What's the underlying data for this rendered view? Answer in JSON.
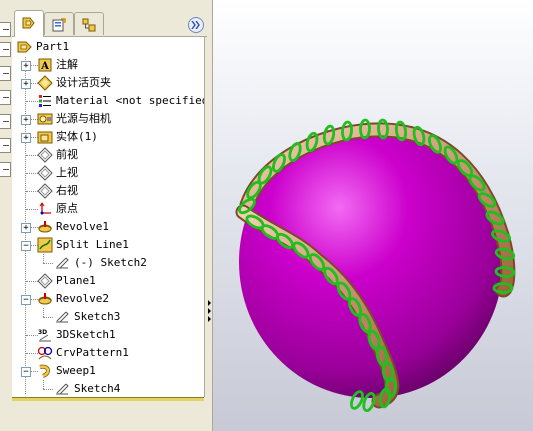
{
  "left_strip": {
    "boxes": [
      "",
      "",
      "",
      "",
      "",
      "",
      ""
    ]
  },
  "panel": {
    "tabs": [
      {
        "icon": "feature-manager-icon",
        "active": true
      },
      {
        "icon": "property-manager-icon",
        "active": false
      },
      {
        "icon": "configuration-manager-icon",
        "active": false
      }
    ],
    "expand_icon": "double-chevron-right-icon"
  },
  "tree": {
    "root": {
      "label": "Part1",
      "icon": "part-icon"
    },
    "items": [
      {
        "label": "注解",
        "icon": "annotations-icon",
        "expander": "+"
      },
      {
        "label": "设计活页夹",
        "icon": "design-binder-icon",
        "expander": "+"
      },
      {
        "label": "Material <not specified>",
        "icon": "material-icon",
        "expander": ""
      },
      {
        "label": "光源与相机",
        "icon": "lights-cameras-icon",
        "expander": "+"
      },
      {
        "label": "实体(1)",
        "icon": "solid-bodies-icon",
        "expander": "+"
      },
      {
        "label": "前视",
        "icon": "plane-icon",
        "expander": ""
      },
      {
        "label": "上视",
        "icon": "plane-icon",
        "expander": ""
      },
      {
        "label": "右视",
        "icon": "plane-icon",
        "expander": ""
      },
      {
        "label": "原点",
        "icon": "origin-icon",
        "expander": ""
      },
      {
        "label": "Revolve1",
        "icon": "revolve-icon",
        "expander": "+"
      },
      {
        "label": "Split Line1",
        "icon": "split-line-icon",
        "expander": "−"
      },
      {
        "label": "(-) Sketch2",
        "icon": "sketch-icon",
        "expander": "",
        "child": true
      },
      {
        "label": "Plane1",
        "icon": "plane-icon",
        "expander": ""
      },
      {
        "label": "Revolve2",
        "icon": "revolve-icon",
        "expander": "−"
      },
      {
        "label": "Sketch3",
        "icon": "sketch-icon",
        "expander": "",
        "child": true
      },
      {
        "label": "3DSketch1",
        "icon": "3d-sketch-icon",
        "expander": ""
      },
      {
        "label": "CrvPattern1",
        "icon": "curve-pattern-icon",
        "expander": ""
      },
      {
        "label": "Sweep1",
        "icon": "sweep-icon",
        "expander": "−"
      },
      {
        "label": "Sketch4",
        "icon": "sketch-icon",
        "expander": "",
        "child": true
      }
    ]
  },
  "colors": {
    "sphere": "#cc00cc",
    "sweep_tube": "#d9a37a",
    "rings": "#1fbf1f",
    "panel_bg": "#ece9d8",
    "splitter": "#e4d35c"
  }
}
